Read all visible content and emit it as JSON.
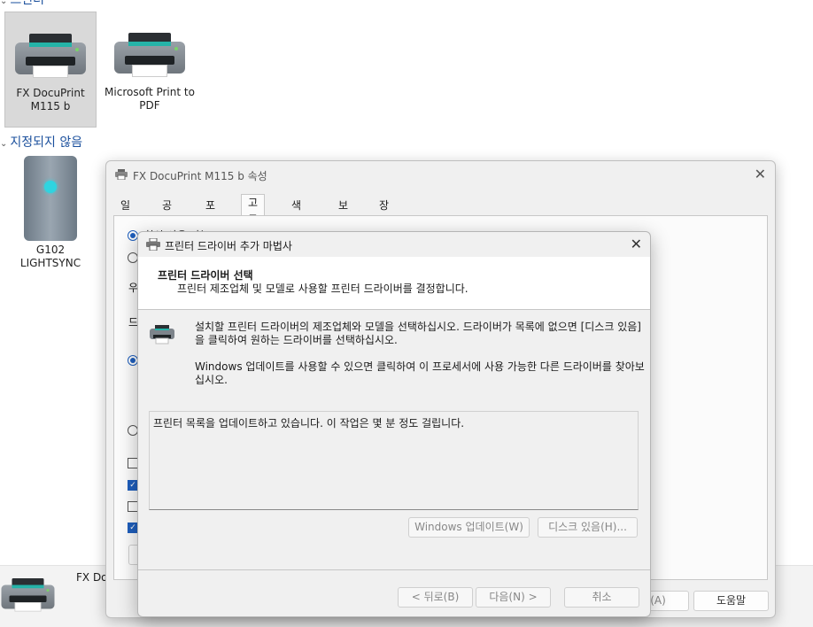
{
  "groups": {
    "printers_label": "프린터",
    "unspecified_label": "지정되지 않음"
  },
  "devices": {
    "fx_label": "FX DocuPrint M115 b",
    "pdf_label": "Microsoft Print to PDF",
    "g102_label": "G102 LIGHTSYNC"
  },
  "bottom": {
    "name": "FX Doc"
  },
  "properties": {
    "title": "FX DocuPrint M115 b 속성",
    "tabs": [
      "일반",
      "공유",
      "포트",
      "고급",
      "색 관리",
      "보안",
      "장치 설정"
    ],
    "active_tab": "고급",
    "frag_avail": "항상 사용 가능",
    "frag_priority": "우",
    "frag_driver": "드",
    "apply_label": "적용(A)",
    "help_label": "도움말"
  },
  "wizard": {
    "title": "프린터 드라이버 추가 마법사",
    "header_title": "프린터 드라이버 선택",
    "header_subtitle": "프린터 제조업체 및 모델로 사용할 프린터 드라이버를 결정합니다.",
    "desc1": "설치할 프린터 드라이버의 제조업체와 모델을 선택하십시오. 드라이버가 목록에 없으면 [디스크 있음]을 클릭하여 원하는 드라이버를 선택하십시오.",
    "desc2": "Windows 업데이트를 사용할 수 있으면 클릭하여 이 프로세서에 사용 가능한 다른 드라이버를 찾아보십시오.",
    "list_status": "프린터 목록을 업데이트하고 있습니다. 이 작업은 몇 분 정도 걸립니다.",
    "windows_update_label": "Windows 업데이트(W)",
    "have_disk_label": "디스크 있음(H)...",
    "back_label": "< 뒤로(B)",
    "next_label": "다음(N) >",
    "cancel_label": "취소"
  },
  "colors": {
    "accent": "#1f5fbd",
    "group_header": "#1a4f9c",
    "printer_accent": "#25b3a8"
  }
}
